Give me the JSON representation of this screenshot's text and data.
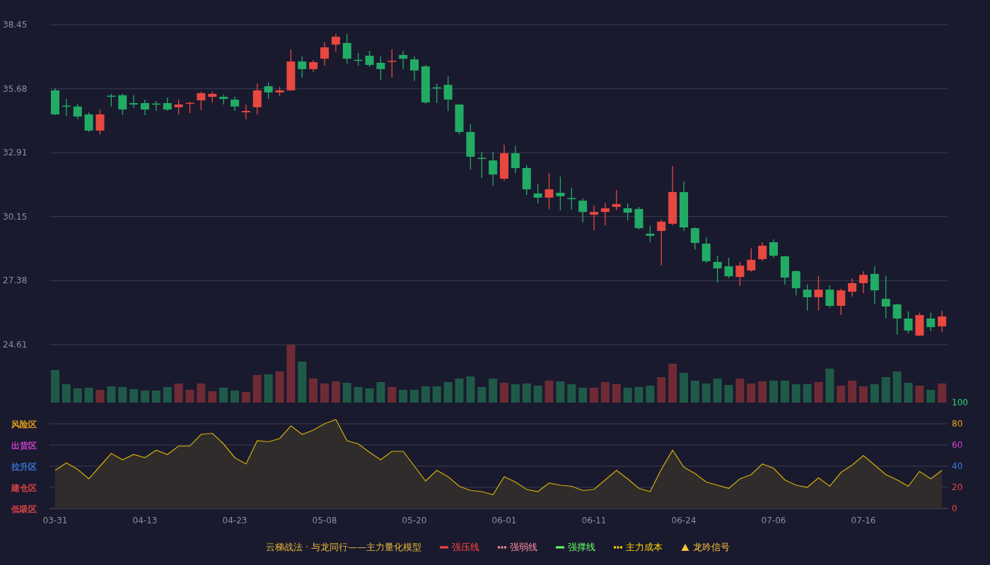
{
  "price_chart": {
    "chart_data": {
      "type": "candlestick",
      "categories": [
        null,
        null,
        null,
        null,
        null,
        null,
        null,
        null,
        null,
        null,
        null,
        null,
        null,
        null,
        null,
        null,
        null,
        null,
        null,
        null,
        null,
        null,
        null,
        null,
        null,
        null,
        null,
        null,
        null,
        null,
        null,
        null,
        null,
        null,
        null,
        null,
        null,
        null,
        null,
        null,
        null,
        null,
        null,
        null,
        null,
        null,
        null,
        null,
        null,
        null,
        null,
        null,
        null,
        null,
        null,
        null,
        null,
        null,
        null,
        null,
        null,
        null,
        null,
        null,
        null,
        null,
        null,
        null,
        null,
        null,
        null,
        null,
        null,
        null,
        null,
        null,
        null,
        null,
        null,
        null
      ],
      "grid": true,
      "ylim": [
        24.61,
        38.45
      ],
      "yticks": [
        {
          "value": 38.45,
          "label": "38.45"
        },
        {
          "value": 35.68,
          "label": "35.68"
        },
        {
          "value": 32.91,
          "label": "32.91"
        },
        {
          "value": 30.15,
          "label": "30.15"
        },
        {
          "value": 27.38,
          "label": "27.38"
        },
        {
          "value": 24.61,
          "label": "24.61"
        }
      ],
      "ohlc": [
        [
          35.61,
          35.7,
          34.54,
          34.57
        ],
        [
          34.95,
          35.24,
          34.51,
          34.93
        ],
        [
          34.91,
          35.03,
          34.36,
          34.48
        ],
        [
          34.57,
          34.66,
          33.81,
          33.87
        ],
        [
          33.87,
          34.78,
          33.71,
          34.57
        ],
        [
          35.38,
          35.46,
          34.91,
          35.36
        ],
        [
          35.4,
          35.46,
          34.54,
          34.78
        ],
        [
          35.06,
          35.4,
          34.85,
          35.0
        ],
        [
          35.06,
          35.21,
          34.54,
          34.78
        ],
        [
          35.04,
          35.15,
          34.72,
          35.02
        ],
        [
          35.06,
          35.3,
          34.72,
          34.78
        ],
        [
          34.88,
          35.21,
          34.57,
          35.0
        ],
        [
          35.05,
          35.12,
          34.63,
          35.07
        ],
        [
          35.18,
          35.55,
          34.75,
          35.49
        ],
        [
          35.33,
          35.55,
          35.09,
          35.46
        ],
        [
          35.33,
          35.43,
          35.0,
          35.24
        ],
        [
          35.21,
          35.33,
          34.72,
          34.91
        ],
        [
          34.66,
          35.0,
          34.36,
          34.72
        ],
        [
          34.88,
          35.91,
          34.57,
          35.61
        ],
        [
          35.79,
          35.95,
          35.24,
          35.52
        ],
        [
          35.52,
          35.76,
          35.37,
          35.61
        ],
        [
          35.61,
          37.38,
          35.6,
          36.86
        ],
        [
          36.86,
          37.08,
          36.16,
          36.53
        ],
        [
          36.53,
          36.92,
          36.4,
          36.83
        ],
        [
          36.98,
          37.69,
          36.68,
          37.47
        ],
        [
          37.59,
          38.05,
          37.29,
          37.93
        ],
        [
          37.66,
          38.05,
          36.77,
          36.98
        ],
        [
          36.93,
          37.23,
          36.68,
          36.91
        ],
        [
          37.11,
          37.32,
          36.62,
          36.71
        ],
        [
          36.8,
          37.08,
          36.07,
          36.53
        ],
        [
          36.86,
          37.38,
          36.16,
          36.89
        ],
        [
          37.14,
          37.32,
          36.53,
          36.98
        ],
        [
          36.95,
          37.08,
          36.01,
          36.47
        ],
        [
          36.65,
          36.71,
          35.03,
          35.09
        ],
        [
          35.74,
          35.91,
          35.06,
          35.72
        ],
        [
          35.85,
          36.22,
          34.72,
          35.21
        ],
        [
          35.0,
          35.0,
          33.71,
          33.81
        ],
        [
          33.81,
          34.14,
          32.19,
          32.74
        ],
        [
          32.69,
          32.95,
          31.82,
          32.67
        ],
        [
          32.58,
          32.95,
          31.48,
          31.97
        ],
        [
          31.79,
          33.26,
          31.7,
          32.89
        ],
        [
          32.89,
          33.2,
          32.03,
          32.25
        ],
        [
          32.25,
          32.37,
          31.09,
          31.33
        ],
        [
          31.15,
          31.55,
          30.72,
          30.97
        ],
        [
          30.97,
          32.03,
          30.48,
          31.33
        ],
        [
          31.18,
          31.88,
          30.42,
          31.03
        ],
        [
          30.95,
          31.39,
          30.45,
          30.93
        ],
        [
          30.84,
          30.94,
          29.9,
          30.35
        ],
        [
          30.23,
          30.63,
          29.56,
          30.35
        ],
        [
          30.35,
          30.75,
          29.77,
          30.51
        ],
        [
          30.57,
          31.3,
          30.42,
          30.69
        ],
        [
          30.51,
          30.72,
          29.99,
          30.32
        ],
        [
          30.48,
          30.57,
          29.59,
          29.65
        ],
        [
          29.41,
          29.74,
          29.04,
          29.32
        ],
        [
          29.53,
          30.02,
          28.03,
          29.93
        ],
        [
          29.84,
          32.34,
          29.77,
          31.21
        ],
        [
          31.21,
          31.67,
          29.53,
          29.68
        ],
        [
          29.65,
          29.68,
          28.73,
          29.01
        ],
        [
          28.98,
          29.25,
          28.15,
          28.22
        ],
        [
          28.19,
          28.46,
          27.3,
          27.91
        ],
        [
          28.0,
          28.37,
          27.48,
          27.57
        ],
        [
          27.54,
          28.19,
          27.15,
          28.03
        ],
        [
          27.82,
          28.77,
          27.76,
          28.28
        ],
        [
          28.31,
          29.04,
          28.22,
          28.89
        ],
        [
          29.04,
          29.16,
          28.37,
          28.46
        ],
        [
          28.43,
          28.46,
          27.21,
          27.51
        ],
        [
          27.79,
          27.82,
          26.75,
          27.05
        ],
        [
          26.99,
          27.21,
          26.08,
          26.66
        ],
        [
          26.66,
          27.58,
          26.08,
          26.99
        ],
        [
          26.99,
          27.18,
          26.2,
          26.29
        ],
        [
          26.29,
          27.03,
          25.89,
          26.96
        ],
        [
          26.9,
          27.48,
          26.69,
          27.27
        ],
        [
          27.27,
          27.79,
          26.84,
          27.63
        ],
        [
          27.67,
          28.0,
          26.38,
          26.96
        ],
        [
          26.59,
          27.6,
          25.74,
          26.26
        ],
        [
          26.35,
          26.38,
          25.04,
          25.74
        ],
        [
          25.74,
          26.05,
          25.1,
          25.22
        ],
        [
          25.0,
          25.99,
          24.99,
          25.89
        ],
        [
          25.74,
          25.99,
          25.19,
          25.37
        ],
        [
          25.4,
          26.08,
          25.16,
          25.83
        ]
      ]
    }
  },
  "indicator_chart": {
    "zones": [
      {
        "label": "风险区",
        "color": "#e8a317"
      },
      {
        "label": "出货区",
        "color": "#d63fd6"
      },
      {
        "label": "拉升区",
        "color": "#3a7be0"
      },
      {
        "label": "建仓区",
        "color": "#e84545"
      },
      {
        "label": "低吸区",
        "color": "#e84545"
      }
    ],
    "chart_data": {
      "type": "area",
      "categories": [
        "03-31",
        null,
        null,
        null,
        null,
        null,
        null,
        null,
        "04-13",
        null,
        null,
        null,
        null,
        null,
        null,
        null,
        "04-23",
        null,
        null,
        null,
        null,
        null,
        null,
        null,
        "05-08",
        null,
        null,
        null,
        null,
        null,
        null,
        null,
        "05-20",
        null,
        null,
        null,
        null,
        null,
        null,
        null,
        "06-01",
        null,
        null,
        null,
        null,
        null,
        null,
        null,
        "06-11",
        null,
        null,
        null,
        null,
        null,
        null,
        null,
        "06-24",
        null,
        null,
        null,
        null,
        null,
        null,
        null,
        "07-06",
        null,
        null,
        null,
        null,
        null,
        null,
        null,
        "07-16",
        null,
        null,
        null,
        null,
        null,
        null,
        null
      ],
      "grid": true,
      "ylim": [
        0,
        100
      ],
      "yticks": [
        100,
        80,
        60,
        40,
        20,
        0
      ],
      "values": [
        36,
        43,
        37,
        28,
        40,
        52,
        46,
        51,
        48,
        55,
        51,
        59,
        59,
        70,
        71,
        61,
        48,
        42,
        64,
        63,
        66,
        78,
        70,
        74,
        80,
        84,
        64,
        61,
        53,
        46,
        54,
        54,
        40,
        26,
        36,
        30,
        21,
        17,
        16,
        13,
        30,
        25,
        18,
        16,
        24,
        22,
        21,
        17,
        18,
        27,
        36,
        28,
        19,
        16,
        37,
        55,
        39,
        33,
        25,
        22,
        19,
        28,
        32,
        42,
        38,
        27,
        22,
        20,
        29,
        21,
        34,
        41,
        50,
        41,
        32,
        27,
        21,
        35,
        28,
        36
      ]
    }
  },
  "legend": {
    "title": "云梯战法 · 与龙同行——主力量化模型",
    "items": [
      {
        "label": "强压线",
        "kind": "line",
        "color": "#ff4545"
      },
      {
        "label": "强弱线",
        "kind": "dashed",
        "color": "#ff8fa0"
      },
      {
        "label": "强撑线",
        "kind": "line",
        "color": "#66ff66"
      },
      {
        "label": "主力成本",
        "kind": "dashed",
        "color": "#ffd700"
      },
      {
        "label": "龙吟信号",
        "kind": "triangle",
        "color": "#ffc43d"
      }
    ]
  }
}
